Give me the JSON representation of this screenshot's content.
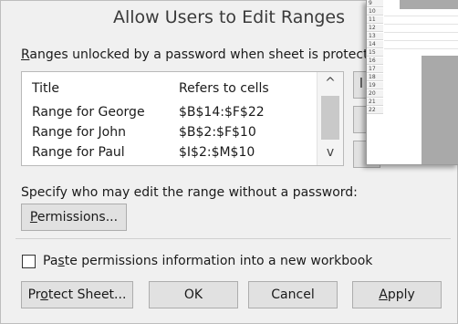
{
  "dialog": {
    "title": "Allow Users to Edit Ranges",
    "ranges_label_u": "R",
    "ranges_label_rest": "anges unlocked by a password when sheet is protecte",
    "columns": {
      "title": "Title",
      "refers": "Refers to cells"
    },
    "rows": [
      {
        "title": "Range for George",
        "refers": "$B$14:$F$22"
      },
      {
        "title": "Range for John",
        "refers": "$B$2:$F$10"
      },
      {
        "title": "Range for Paul",
        "refers": "$I$2:$M$10"
      }
    ],
    "specify_label": "Specify who may edit the range without a password:",
    "permissions_u": "P",
    "permissions_rest": "ermissions...",
    "paste_pre": "Pa",
    "paste_u": "s",
    "paste_rest": "te permissions information into a new workbook",
    "protect_pre": "Pr",
    "protect_u": "o",
    "protect_rest": "tect Sheet...",
    "ok": "OK",
    "cancel": "Cancel",
    "apply_u": "A",
    "apply_rest": "pply",
    "side_button_fragment": "l"
  },
  "scroll_arrows": {
    "up": "^",
    "down": "v"
  },
  "sheet": {
    "row_numbers": [
      "9",
      "10",
      "11",
      "12",
      "13",
      "14",
      "15",
      "16",
      "17",
      "18",
      "19",
      "20",
      "21",
      "22"
    ]
  },
  "colors": {
    "dialog_bg": "#f0f0f0",
    "button_bg": "#e1e1e1",
    "shaded_range": "#a9a9a9"
  }
}
